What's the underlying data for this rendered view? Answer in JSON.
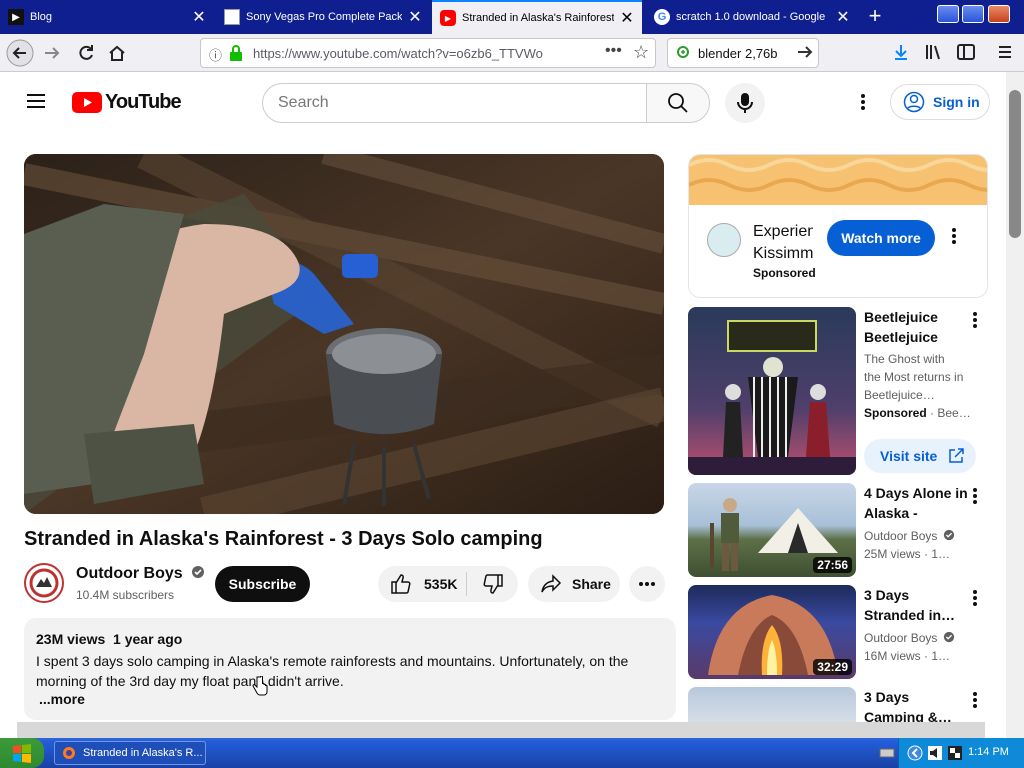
{
  "browser": {
    "tabs": [
      {
        "title": "Blog",
        "active": false
      },
      {
        "title": "Sony Vegas Pro Complete Pack",
        "active": false
      },
      {
        "title": "Stranded in Alaska's Rainforest",
        "active": true
      },
      {
        "title": "scratch 1.0 download - Google",
        "active": false
      }
    ],
    "url": "https://www.youtube.com/watch?v=o6zb6_TTVWo",
    "find_text": "blender 2,76b"
  },
  "youtube": {
    "logo_text": "YouTube",
    "search_placeholder": "Search",
    "sign_in_label": "Sign in"
  },
  "video": {
    "title": "Stranded in Alaska's Rainforest - 3 Days Solo camping",
    "channel": "Outdoor Boys",
    "subscribers": "10.4M subscribers",
    "subscribe_label": "Subscribe",
    "likes": "535K",
    "share_label": "Share",
    "views": "23M views",
    "age": "1 year ago",
    "description": "I spent 3 days solo camping in Alaska's remote rainforests and mountains. Unfortunately, on the morning of the 3rd day my float pane didn't arrive.",
    "more_label": "...more"
  },
  "sidebar": {
    "ad": {
      "title": "Experien Kissimm",
      "sponsored": "Sponsored",
      "cta": "Watch more"
    },
    "items": [
      {
        "title": "Beetlejuice Beetlejuice",
        "line1": "The Ghost with the Most returns in Beetlejuice…",
        "line2_a": "Sponsored",
        "line2_b": "· Bee…",
        "cta": "Visit site"
      },
      {
        "title": "4 Days Alone in Alaska -",
        "channel": "Outdoor Boys",
        "stats": "25M views · 1…",
        "duration": "27:56"
      },
      {
        "title": "3 Days Stranded in…",
        "channel": "Outdoor Boys",
        "stats": "16M views · 1…",
        "duration": "32:29"
      },
      {
        "title": "3 Days Camping &…"
      }
    ]
  },
  "taskbar": {
    "window_title": "Stranded in Alaska's R...",
    "clock": "1:14 PM"
  },
  "colors": {
    "youtube_red": "#ff0000",
    "link_blue": "#065fd4",
    "xp_blue": "#245edb"
  }
}
